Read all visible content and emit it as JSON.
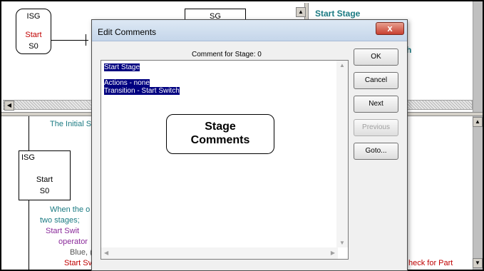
{
  "top_pane": {
    "stage_block": {
      "type": "ISG",
      "name": "Start",
      "number": "S0"
    },
    "sg_box_label": "SG",
    "heading": "Start Stage",
    "partial_text": "h"
  },
  "bottom_pane": {
    "comment_line": "The Initial S",
    "stage_block": {
      "type": "ISG",
      "name": "Start",
      "number": "S0"
    },
    "desc_lines": [
      "When the o",
      "two stages;"
    ],
    "purple_lines": [
      "Start Swit",
      "operator"
    ],
    "blue_line": "Blue, (",
    "red_line": "Start Sv",
    "right_red_text": "heck for Part"
  },
  "dialog": {
    "title": "Edit Comments",
    "close_label": "x",
    "comment_header": "Comment for Stage: 0",
    "text_lines": [
      "Start Stage",
      "",
      "Actions - none",
      "Transition - Start Switch"
    ],
    "buttons": {
      "ok": "OK",
      "cancel": "Cancel",
      "next": "Next",
      "previous": "Previous",
      "goto": "Goto..."
    }
  },
  "callout": {
    "line1": "Stage",
    "line2": "Comments"
  },
  "colors": {
    "teal": "#1a7a82",
    "purple": "#8a2a9a",
    "red": "#c00000",
    "selection": "#000080"
  }
}
